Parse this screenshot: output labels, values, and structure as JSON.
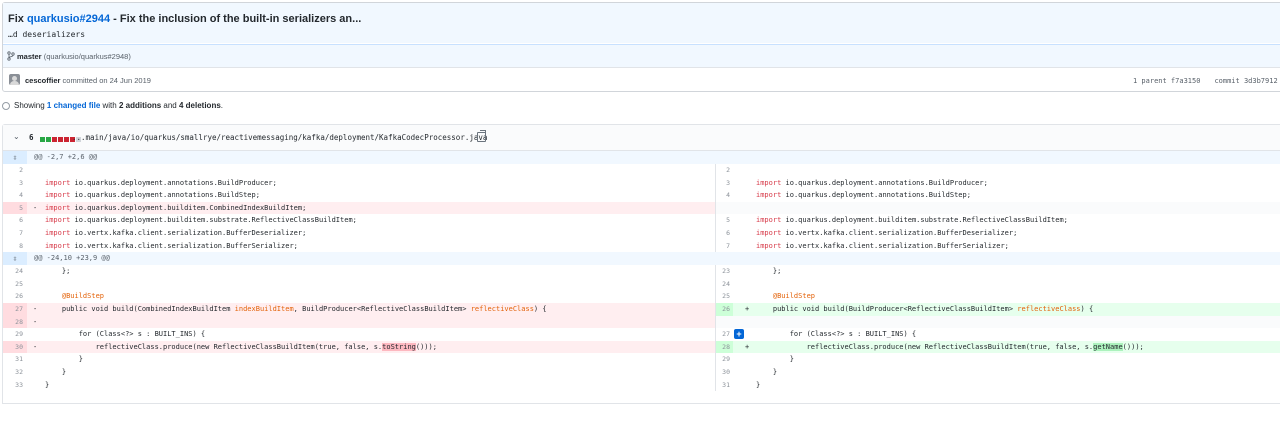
{
  "commit": {
    "title_prefix": "Fix ",
    "issue_ref": "quarkusio#2944",
    "title_suffix": " - Fix the inclusion of the built-in serializers an...",
    "description": "…d deserializers",
    "branch_name": "master",
    "branch_ref": "(quarkusio/quarkus#2948)",
    "author": "cescoffier",
    "committed_text": " committed on 24 Jun 2019",
    "parents_label": "1 parent f7a3150",
    "commit_label": "commit 3d3b7912"
  },
  "summary": {
    "prefix": "Showing ",
    "changed_files": "1 changed file",
    "mid": " with ",
    "additions": "2 additions",
    "and": " and ",
    "deletions": "4 deletions",
    "suffix": "."
  },
  "file": {
    "change_count": "6",
    "diffstat": [
      "add",
      "add",
      "del",
      "del",
      "del",
      "del"
    ],
    "path": "...main/java/io/quarkus/smallrye/reactivemessaging/kafka/deployment/KafkaCodecProcessor.java"
  },
  "hunks": [
    "@@ -2,7 +2,6 @@",
    "@@ -24,10 +23,9 @@"
  ],
  "lines": {
    "h1": [
      {
        "l": "2",
        "r": "2",
        "type": "ctx",
        "code": ""
      },
      {
        "l": "3",
        "r": "3",
        "type": "ctx",
        "code": "import io.quarkus.deployment.annotations.BuildProducer;"
      },
      {
        "l": "4",
        "r": "4",
        "type": "ctx",
        "code": "import io.quarkus.deployment.annotations.BuildStep;"
      },
      {
        "l": "5",
        "r": "",
        "type": "del",
        "code": "import io.quarkus.deployment.builditem.CombinedIndexBuildItem;"
      },
      {
        "l": "6",
        "r": "5",
        "type": "ctx",
        "code": "import io.quarkus.deployment.builditem.substrate.ReflectiveClassBuildItem;"
      },
      {
        "l": "7",
        "r": "6",
        "type": "ctx",
        "code": "import io.vertx.kafka.client.serialization.BufferDeserializer;"
      },
      {
        "l": "8",
        "r": "7",
        "type": "ctx",
        "code": "import io.vertx.kafka.client.serialization.BufferSerializer;"
      }
    ],
    "h2": {
      "l24": "24",
      "r23": "23",
      "c24": "    };",
      "l25": "25",
      "r24": "24",
      "l26": "26",
      "r25": "25",
      "c26": "    @BuildStep",
      "l27": "27",
      "r26": "26",
      "del27a": "    public void build(CombinedIndexBuildItem ",
      "del27b": "indexBuildItem",
      "del27c": ", BuildProducer<ReflectiveClassBuildItem> ",
      "del27d": "reflectiveClass",
      "del27e": ") {",
      "add26a": "    public void build(BuildProducer<ReflectiveClassBuildItem> ",
      "add26b": "reflectiveClass",
      "add26c": ") {",
      "l28": "28",
      "l29": "29",
      "r27": "27",
      "c29": "        for (Class<?> s : BUILT_INS) {",
      "l30": "30",
      "r28": "28",
      "del30a": "            reflectiveClass.produce(new ReflectiveClassBuildItem(true, false, s.",
      "del30b": "toString",
      "del30c": "()));",
      "add28a": "            reflectiveClass.produce(new ReflectiveClassBuildItem(true, false, s.",
      "add28b": "getName",
      "add28c": "()));",
      "l31": "31",
      "r29": "29",
      "c31": "        }",
      "l32": "32",
      "r30": "30",
      "c32": "    }",
      "l33": "33",
      "r31": "31",
      "c33": "}"
    }
  },
  "signs": {
    "del": "-",
    "add": "+"
  },
  "icons": {
    "collapse": "chevron-down-icon",
    "expand": "unfold-icon",
    "copy": "clipboard-icon",
    "branch": "git-branch-icon",
    "add_comment": "plus-icon"
  },
  "colors": {
    "accent": "#0366d6",
    "add": "#28a745",
    "del": "#cb2431"
  }
}
